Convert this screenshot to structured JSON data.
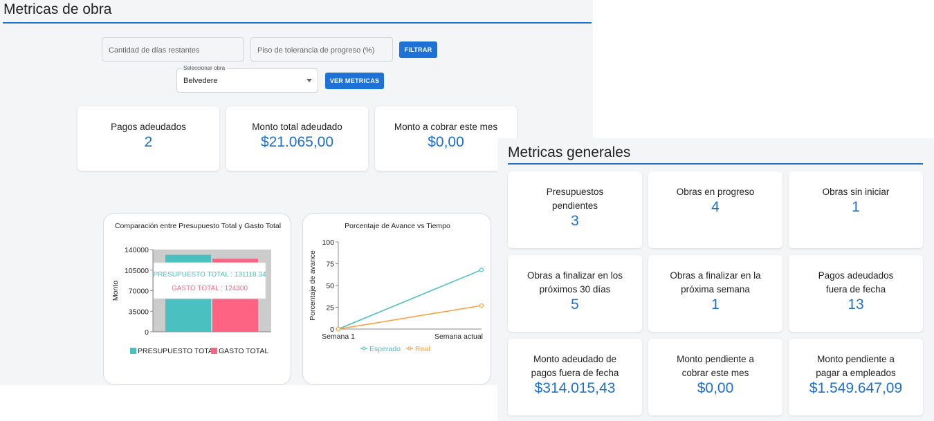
{
  "obra": {
    "title": "Metricas de obra",
    "filters": {
      "dias_placeholder": "Cantidad de días restantes",
      "piso_placeholder": "Piso de tolerancia de progreso (%)",
      "filtrar_label": "FILTRAR",
      "select_label": "Seleccionar obra",
      "select_value": "Belvedere",
      "ver_label": "VER METRICAS"
    },
    "cards": [
      {
        "label": "Pagos adeudados",
        "value": "2"
      },
      {
        "label": "Monto total adeudado",
        "value": "$21.065,00"
      },
      {
        "label": "Monto a cobrar este mes",
        "value": "$0,00"
      }
    ]
  },
  "chart_data": [
    {
      "type": "bar",
      "title": "Comparación entre Presupuesto Total y Gasto Total",
      "ylabel": "Monto",
      "ylim": [
        0,
        140000
      ],
      "yticks": [
        "0",
        "35000",
        "70000",
        "105000",
        "140000"
      ],
      "series": [
        {
          "name": "PRESUPUESTO TOTAL",
          "values": [
            131118.34
          ],
          "color": "#4bc0c0"
        },
        {
          "name": "GASTO TOTAL",
          "values": [
            124300
          ],
          "color": "#ff6384"
        }
      ],
      "tooltip": [
        "PRESUPUESTO TOTAL : 131118.34",
        "GASTO TOTAL : 124300"
      ],
      "legend": "bottom"
    },
    {
      "type": "line",
      "title": "Porcentaje de Avance vs Tiempo",
      "ylabel": "Porcentaje de avance",
      "ylim": [
        0,
        100
      ],
      "yticks": [
        "0",
        "25",
        "50",
        "75",
        "100"
      ],
      "categories": [
        "Semana 1",
        "Semana actual"
      ],
      "series": [
        {
          "name": "Esperado",
          "values": [
            0,
            68
          ],
          "color": "#4bc0c0"
        },
        {
          "name": "Real",
          "values": [
            0,
            27
          ],
          "color": "#ffa040"
        }
      ],
      "legend": "bottom"
    }
  ],
  "general": {
    "title": "Metricas generales",
    "cards": [
      {
        "label": "Presupuestos\npendientes",
        "value": "3"
      },
      {
        "label": "Obras en progreso",
        "value": "4"
      },
      {
        "label": "Obras sin iniciar",
        "value": "1"
      },
      {
        "label": "Obras a finalizar en los\npróximos 30 días",
        "value": "5"
      },
      {
        "label": "Obras a finalizar en la\npróxima semana",
        "value": "1"
      },
      {
        "label": "Pagos adeudados\nfuera de fecha",
        "value": "13"
      },
      {
        "label": "Monto adeudado de\npagos fuera de fecha",
        "value": "$314.015,43"
      },
      {
        "label": "Monto pendiente a\ncobrar este mes",
        "value": "$0,00"
      },
      {
        "label": "Monto pendiente a\npagar a empleados",
        "value": "$1.549.647,09"
      }
    ]
  }
}
